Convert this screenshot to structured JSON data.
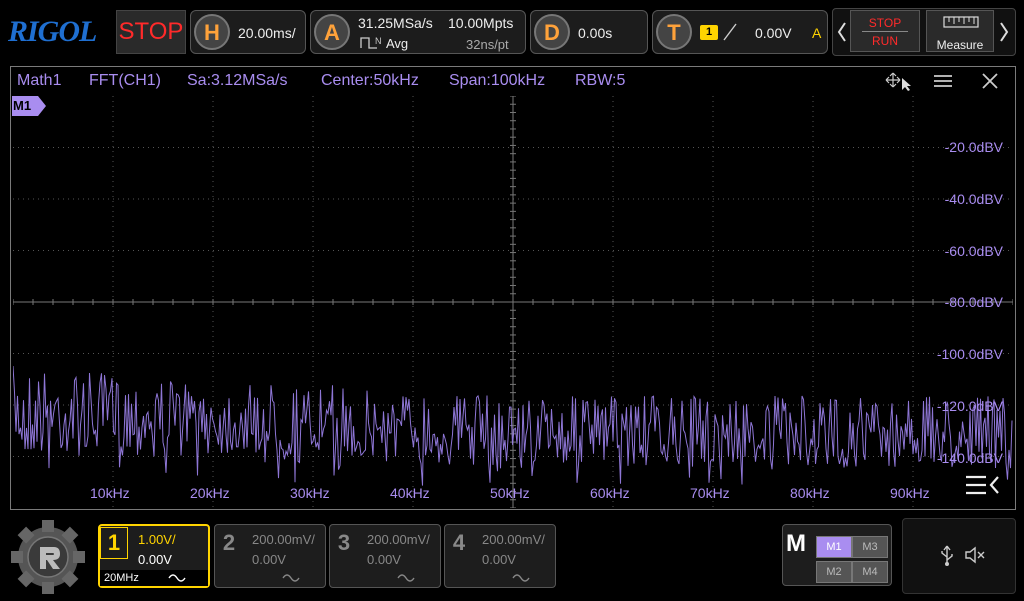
{
  "colors": {
    "accent": "#a98df0",
    "trigger": "#ffd400",
    "stop": "#ff2a2a",
    "label": "#ffa23a"
  },
  "brand": "RIGOL",
  "status": "STOP",
  "horizontal": {
    "key": "H",
    "timebase": "20.00ms/"
  },
  "acquire": {
    "key": "A",
    "sample_rate": "31.25MSa/s",
    "mode_icon": "N",
    "mode": "Avg",
    "depth": "10.00Mpts",
    "period": "32ns/pt"
  },
  "delay": {
    "key": "D",
    "value": "0.00s"
  },
  "trigger": {
    "key": "T",
    "source": "1",
    "level": "0.00V",
    "mode": "A"
  },
  "run_control": {
    "stop": "STOP",
    "run": "RUN"
  },
  "measure": {
    "label": "Measure"
  },
  "math_window": {
    "name": "Math1",
    "operation": "FFT(CH1)",
    "sa": "Sa:3.12MSa/s",
    "center": "Center:50kHz",
    "span": "Span:100kHz",
    "rbw": "RBW:5",
    "marker": "M1",
    "y_labels": [
      "-20.0dBV",
      "-40.0dBV",
      "-60.0dBV",
      "-80.0dBV",
      "-100.0dBV",
      "-120.0dBV",
      "-140.0dBV"
    ],
    "x_labels": [
      "10kHz",
      "20kHz",
      "30kHz",
      "40kHz",
      "50kHz",
      "60kHz",
      "70kHz",
      "80kHz",
      "90kHz"
    ]
  },
  "channels": [
    {
      "num": "1",
      "scale": "1.00V/",
      "offset": "0.00V",
      "bw": "20MHz",
      "active": true
    },
    {
      "num": "2",
      "scale": "200.00mV/",
      "offset": "0.00V",
      "active": false
    },
    {
      "num": "3",
      "scale": "200.00mV/",
      "offset": "0.00V",
      "active": false
    },
    {
      "num": "4",
      "scale": "200.00mV/",
      "offset": "0.00V",
      "active": false
    }
  ],
  "math_menu": {
    "key": "M",
    "items": [
      "M1",
      "M3",
      "M2",
      "M4"
    ]
  }
}
